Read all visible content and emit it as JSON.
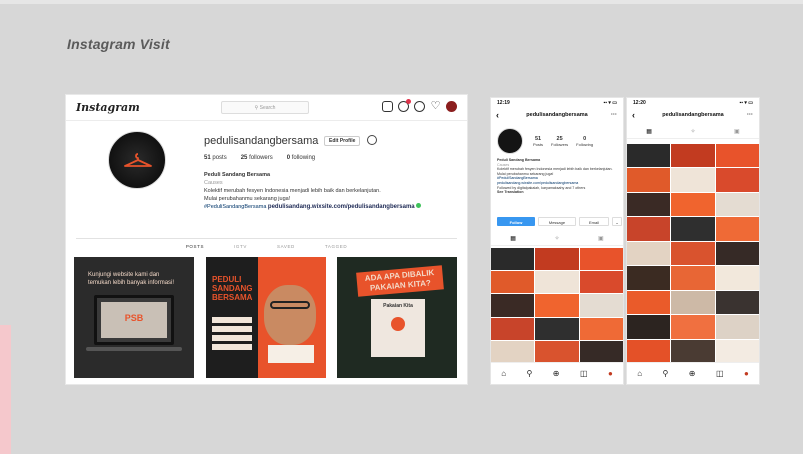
{
  "slide": {
    "title": "Instagram Visit"
  },
  "desktop": {
    "logo": "Instagram",
    "search_placeholder": "Search",
    "username": "pedulisandangbersama",
    "edit_profile_label": "Edit Profile",
    "stats": [
      {
        "value": "51",
        "label": "posts"
      },
      {
        "value": "25",
        "label": "followers"
      },
      {
        "value": "0",
        "label": "following"
      }
    ],
    "bio": {
      "name": "Peduli Sandang Bersama",
      "category": "Causes",
      "line1": "Kolektif merubah fesyen Indonesia menjadi lebih baik dan berkelanjutan.",
      "line2": "Mulai perubahanmu sekarang juga!",
      "hashtag": "#PeduliSandangBersama",
      "website": "pedulisandang.wixsite.com/pedulisandangbersama"
    },
    "tabs": [
      "POSTS",
      "IGTV",
      "SAVED",
      "TAGGED"
    ],
    "posts": [
      {
        "text": "Kunjungi website kami dan temukan lebih banyak informasi!",
        "sub": "PSB"
      },
      {
        "text": "PEDULI SANDANG BERSAMA",
        "sub": ""
      },
      {
        "text": "ADA APA DIBALIK PAKAIAN KITA?",
        "sub": "Pakaian Kita"
      }
    ],
    "colors": {
      "accent": "#e8532b",
      "dark": "#2b2b2b",
      "link": "#003569"
    }
  },
  "phone1": {
    "time": "12:19",
    "header": "pedulisandangbersama",
    "stats": [
      {
        "value": "51",
        "label": "Posts"
      },
      {
        "value": "25",
        "label": "Followers"
      },
      {
        "value": "0",
        "label": "Following"
      }
    ],
    "bio_name": "Peduli Sandang Bersama",
    "bio_category": "Causes",
    "bio_text": "Kolektif merubah fesyen Indonesia menjadi lebih baik dan berkelanjutan.",
    "bio_cta": "Mulai perubahanmu sekarang juga!",
    "bio_hashtag": "#PeduliSandangBersama",
    "bio_link": "pedulisandang.wixsite.com/pedulisandangbersama",
    "followed_by": "Followed by digitalpakaiah, karyamaksahy and 7 others",
    "see_translation": "See Translation",
    "buttons": {
      "follow": "Follow",
      "message": "Message",
      "email": "Email"
    }
  },
  "phone2": {
    "time": "12:20",
    "header": "pedulisandangbersama"
  },
  "grid_colors": [
    "#2a2a2a",
    "#c23b20",
    "#e8532b",
    "#e05a2a",
    "#efe4d8",
    "#d94a2c",
    "#3a2a25",
    "#f0642e",
    "#e4dcd2",
    "#c8442a",
    "#2f2f2f",
    "#ef6a36",
    "#e3d3c3",
    "#d9532e",
    "#362a26",
    "#3b2b22",
    "#e86635",
    "#f2e8dc",
    "#ea5b2a",
    "#cdb9a6",
    "#3a3330",
    "#2c2420",
    "#f07040",
    "#ddd2c6",
    "#e45128",
    "#4a3b33",
    "#f3ebe2"
  ]
}
